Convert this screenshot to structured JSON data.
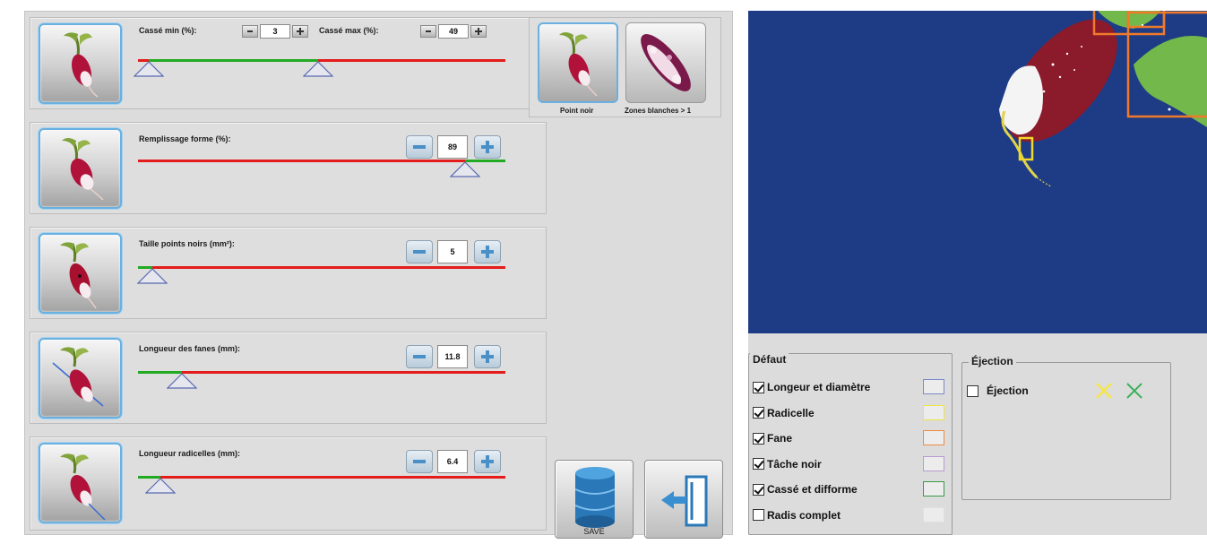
{
  "rows": [
    {
      "id": "broken",
      "label_min": "Cassé min (%):",
      "value_min": "3",
      "label_max": "Cassé max (%):",
      "value_max": "49",
      "range_min": 3,
      "range_max": 49
    },
    {
      "id": "fill",
      "label": "Remplissage forme (%):",
      "value": "89",
      "level": 0.89
    },
    {
      "id": "black-spots",
      "label": "Taille points noirs (mm²):",
      "value": "5",
      "level": 0.04
    },
    {
      "id": "leaf-length",
      "label": "Longueur des fanes (mm):",
      "value": "11.8",
      "level": 0.12
    },
    {
      "id": "root-length",
      "label": "Longueur radicelles (mm):",
      "value": "6.4",
      "level": 0.06
    }
  ],
  "tiles": {
    "black_point": "Point noir",
    "white_zones": "Zones blanches > 1"
  },
  "actions": {
    "save": "SAVE"
  },
  "defaut": {
    "title": "Défaut",
    "items": [
      {
        "label": "Longeur et diamètre",
        "checked": true,
        "color": "#7b88c9"
      },
      {
        "label": "Radicelle",
        "checked": true,
        "color": "#f0e442"
      },
      {
        "label": "Fane",
        "checked": true,
        "color": "#f08a3c"
      },
      {
        "label": "Tâche noir",
        "checked": true,
        "color": "#b89ad2"
      },
      {
        "label": "Cassé et difforme",
        "checked": true,
        "color": "#3a9a4a"
      },
      {
        "label": "Radis complet",
        "checked": false,
        "color": "#e0e0e0"
      }
    ]
  },
  "ejection": {
    "title": "Éjection",
    "checkbox_label": "Éjection",
    "checked": false
  },
  "colors": {
    "track_red": "#e41c1c",
    "track_green": "#22aa22",
    "vision_bg": "#1e3c85",
    "radish_red": "#8b1a2a",
    "leaf_green": "#72b84a",
    "detect_orange": "#f07a2a",
    "detect_yellow": "#f0d82a",
    "icon_yellow_x": "#f5e64a",
    "icon_green_x": "#3ab05a"
  }
}
